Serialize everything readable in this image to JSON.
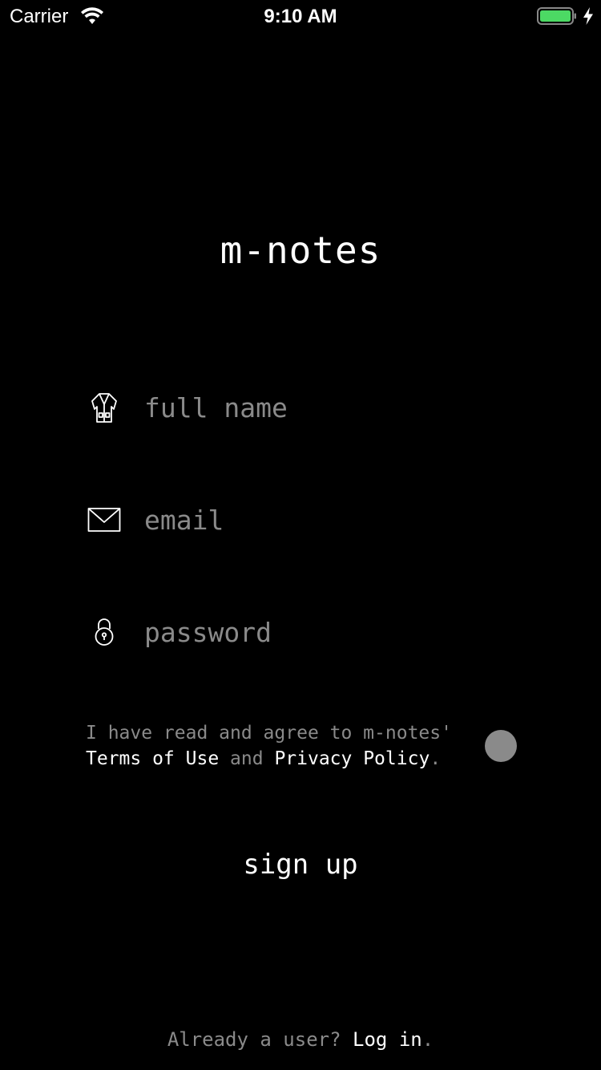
{
  "status_bar": {
    "carrier": "Carrier",
    "time": "9:10 AM",
    "battery_color": "#4cd964"
  },
  "app": {
    "title": "m-notes"
  },
  "form": {
    "full_name": {
      "placeholder": "full name",
      "value": "",
      "icon": "coat-icon"
    },
    "email": {
      "placeholder": "email",
      "value": "",
      "icon": "envelope-icon"
    },
    "password": {
      "placeholder": "password",
      "value": "",
      "icon": "lock-icon"
    }
  },
  "terms": {
    "prefix": "I have read and agree to m-notes'",
    "terms_link": "Terms of Use",
    "conjunction": "and",
    "privacy_link": "Privacy Policy",
    "period": ".",
    "toggle_color": "#8a8a8a"
  },
  "actions": {
    "signup_label": "sign up"
  },
  "footer": {
    "prompt": "Already a user?",
    "login_link": "Log in",
    "period": "."
  }
}
